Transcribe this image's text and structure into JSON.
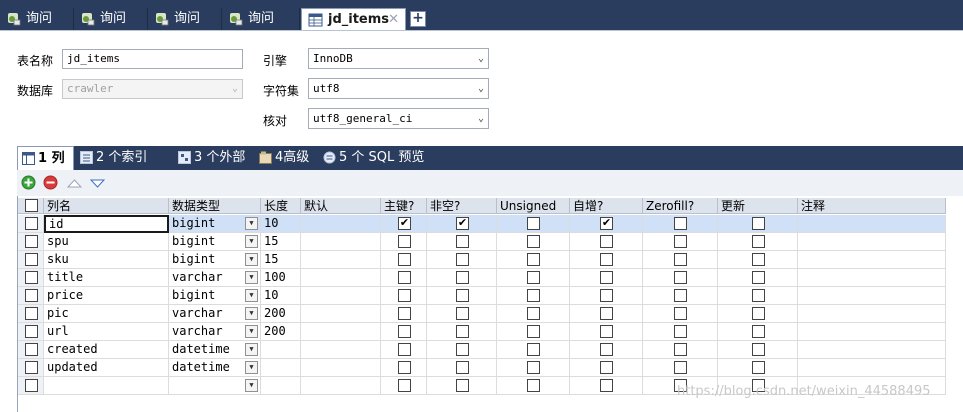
{
  "tabs": [
    {
      "label": "询问",
      "active": false
    },
    {
      "label": "询问",
      "active": false
    },
    {
      "label": "询问",
      "active": false
    },
    {
      "label": "询问",
      "active": false
    },
    {
      "label": "jd_items",
      "active": true
    }
  ],
  "add_tab_label": "+",
  "close_label": "✕",
  "form": {
    "table_name_label": "表名称",
    "table_name_value": "jd_items",
    "database_label": "数据库",
    "database_value": "crawler",
    "engine_label": "引擎",
    "engine_value": "InnoDB",
    "charset_label": "字符集",
    "charset_value": "utf8",
    "collation_label": "核对",
    "collation_value": "utf8_general_ci"
  },
  "subtabs": [
    "1 列",
    "2 个索引",
    "3 个外部键",
    "4高级",
    "5 个 SQL 预览"
  ],
  "columns_headers": [
    "列名",
    "数据类型",
    "长度",
    "默认",
    "主键?",
    "非空?",
    "Unsigned",
    "自增?",
    "Zerofill?",
    "更新",
    "注释"
  ],
  "rows": [
    {
      "name": "id",
      "type": "bigint",
      "length": "10",
      "pk": true,
      "notnull": true,
      "ai": true,
      "selected": true
    },
    {
      "name": "spu",
      "type": "bigint",
      "length": "15",
      "pk": false,
      "notnull": false,
      "ai": false,
      "selected": false
    },
    {
      "name": "sku",
      "type": "bigint",
      "length": "15",
      "pk": false,
      "notnull": false,
      "ai": false,
      "selected": false
    },
    {
      "name": "title",
      "type": "varchar",
      "length": "100",
      "pk": false,
      "notnull": false,
      "ai": false,
      "selected": false
    },
    {
      "name": "price",
      "type": "bigint",
      "length": "10",
      "pk": false,
      "notnull": false,
      "ai": false,
      "selected": false
    },
    {
      "name": "pic",
      "type": "varchar",
      "length": "200",
      "pk": false,
      "notnull": false,
      "ai": false,
      "selected": false
    },
    {
      "name": "url",
      "type": "varchar",
      "length": "200",
      "pk": false,
      "notnull": false,
      "ai": false,
      "selected": false
    },
    {
      "name": "created",
      "type": "datetime",
      "length": "",
      "pk": false,
      "notnull": false,
      "ai": false,
      "selected": false
    },
    {
      "name": "updated",
      "type": "datetime",
      "length": "",
      "pk": false,
      "notnull": false,
      "ai": false,
      "selected": false
    },
    {
      "name": "",
      "type": "",
      "length": "",
      "pk": false,
      "notnull": false,
      "ai": false,
      "selected": false
    }
  ],
  "check_mark": "✔",
  "dropdown_glyph": "▼",
  "watermark": "https://blog.csdn.net/weixin_44588495"
}
